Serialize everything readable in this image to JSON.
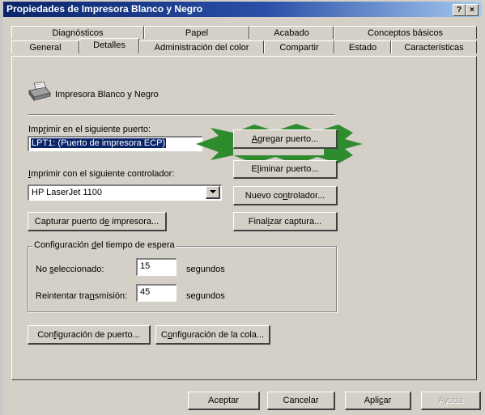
{
  "window": {
    "title": "Propiedades de Impresora Blanco y Negro",
    "help_label": "?",
    "close_label": "×"
  },
  "tabs_row1": [
    "Diagnósticos",
    "Papel",
    "Acabado",
    "Conceptos básicos"
  ],
  "tabs_row2": [
    "General",
    "Detalles",
    "Administración del color",
    "Compartir",
    "Estado",
    "Características"
  ],
  "active_tab": "Detalles",
  "printer_name": "Impresora Blanco y Negro",
  "port": {
    "label_pre": "Imp",
    "label_u": "r",
    "label_post": "imir en el siguiente puerto:",
    "value": "LPT1:  (Puerto de impresora ECP)"
  },
  "add_port": {
    "pre": "",
    "u": "A",
    "post": "gregar puerto..."
  },
  "remove_port": {
    "pre": "E",
    "u": "l",
    "post": "iminar puerto..."
  },
  "driver": {
    "label_pre": "",
    "label_u": "I",
    "label_post": "mprimir con el siguiente controlador:",
    "value": "HP LaserJet 1100"
  },
  "new_driver": {
    "pre": "Nuevo co",
    "u": "n",
    "post": "trolador..."
  },
  "capture_port": {
    "pre": "Capturar puerto d",
    "u": "e",
    "post": " impresora..."
  },
  "end_capture": {
    "pre": "Final",
    "u": "i",
    "post": "zar captura..."
  },
  "timeout_group": {
    "title_pre": "Configuración ",
    "title_u": "d",
    "title_post": "el tiempo de espera",
    "not_selected": {
      "pre": "No ",
      "u": "s",
      "post": "eleccionado:",
      "value": "15",
      "unit": "segundos"
    },
    "retry": {
      "pre": "Reintentar tra",
      "u": "n",
      "post": "smisión:",
      "value": "45",
      "unit": "segundos"
    }
  },
  "port_settings": {
    "pre": "Con",
    "u": "f",
    "post": "iguración de puerto..."
  },
  "queue_settings": {
    "pre": "C",
    "u": "o",
    "post": "nfiguración de la cola..."
  },
  "footer": {
    "ok": "Aceptar",
    "cancel": "Cancelar",
    "apply": {
      "pre": "Apli",
      "u": "c",
      "post": "ar"
    },
    "help": "Ayuda"
  },
  "colors": {
    "dialog_bg": "#d4d0c8",
    "title_start": "#0a246a",
    "title_end": "#a6caf0",
    "selection": "#0a246a",
    "highlight_burst": "#2e8b2e"
  },
  "icons": [
    "printer-icon",
    "help-icon",
    "close-icon",
    "dropdown-arrow-icon"
  ]
}
